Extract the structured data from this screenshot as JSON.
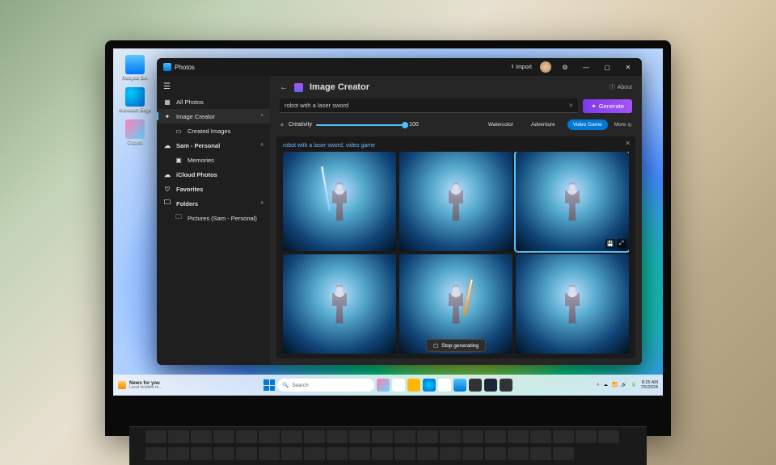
{
  "desktop": {
    "icons": [
      {
        "label": "Recycle Bin",
        "cls": "ico-recycle"
      },
      {
        "label": "Microsoft Edge",
        "cls": "ico-edge"
      },
      {
        "label": "Copilot",
        "cls": "ico-copilot"
      }
    ]
  },
  "window": {
    "app_name": "Photos",
    "import_label": "Import",
    "min_glyph": "—",
    "max_glyph": "▢",
    "close_glyph": "✕"
  },
  "sidebar": {
    "all_photos": "All Photos",
    "image_creator": "Image Creator",
    "created_images": "Created Images",
    "account": "Sam - Personal",
    "memories": "Memories",
    "icloud": "iCloud Photos",
    "favorites": "Favorites",
    "folders": "Folders",
    "folder_item": "Pictures (Sam - Personal)"
  },
  "main": {
    "title": "Image Creator",
    "about": "About",
    "prompt_value": "robot with a laser sword",
    "generate_label": "Generate",
    "creativity_label": "Creativity",
    "creativity_value": "100",
    "styles": [
      "Watercolor",
      "Adventure",
      "Video Game"
    ],
    "active_style_index": 2,
    "more_label": "More",
    "results_caption": "robot with a laser sword, video game",
    "stop_label": "Stop generating"
  },
  "taskbar": {
    "widget_title": "News for you",
    "widget_sub": "Local incident m…",
    "search_placeholder": "Search",
    "time": "8:25 AM",
    "date": "7/5/2024"
  }
}
